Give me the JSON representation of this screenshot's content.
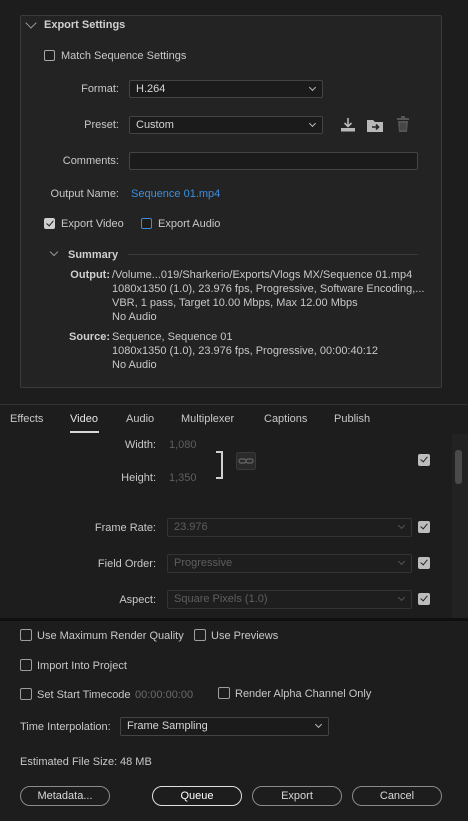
{
  "export_settings": {
    "title": "Export Settings",
    "match_sequence_label": "Match Sequence Settings",
    "format_label": "Format:",
    "format_value": "H.264",
    "preset_label": "Preset:",
    "preset_value": "Custom",
    "comments_label": "Comments:",
    "comments_value": "",
    "output_name_label": "Output Name:",
    "output_name_value": "Sequence 01.mp4",
    "export_video_label": "Export Video",
    "export_audio_label": "Export Audio"
  },
  "summary": {
    "title": "Summary",
    "output_label": "Output:",
    "output_lines": [
      "/Volume...019/Sharkerio/Exports/Vlogs MX/Sequence 01.mp4",
      "1080x1350 (1.0), 23.976 fps, Progressive, Software Encoding,...",
      "VBR, 1 pass, Target 10.00 Mbps, Max 12.00 Mbps",
      "No Audio"
    ],
    "source_label": "Source:",
    "source_lines": [
      "Sequence, Sequence 01",
      "1080x1350 (1.0), 23.976 fps, Progressive, 00:00:40:12",
      "No Audio"
    ]
  },
  "tabs": [
    {
      "label": "Effects"
    },
    {
      "label": "Video"
    },
    {
      "label": "Audio"
    },
    {
      "label": "Multiplexer"
    },
    {
      "label": "Captions"
    },
    {
      "label": "Publish"
    }
  ],
  "video": {
    "width_label": "Width:",
    "width_value": "1,080",
    "height_label": "Height:",
    "height_value": "1,350",
    "frame_rate_label": "Frame Rate:",
    "frame_rate_value": "23.976",
    "field_order_label": "Field Order:",
    "field_order_value": "Progressive",
    "aspect_label": "Aspect:",
    "aspect_value": "Square Pixels (1.0)"
  },
  "options": {
    "max_render_quality": "Use Maximum Render Quality",
    "use_previews": "Use Previews",
    "import_into_project": "Import Into Project",
    "set_start_timecode": "Set Start Timecode",
    "start_timecode_value": "00:00:00:00",
    "render_alpha": "Render Alpha Channel Only",
    "time_interpolation_label": "Time Interpolation:",
    "time_interpolation_value": "Frame Sampling",
    "estimated_size_label": "Estimated File Size:",
    "estimated_size_value": "48 MB"
  },
  "buttons": {
    "metadata": "Metadata...",
    "queue": "Queue",
    "export": "Export",
    "cancel": "Cancel"
  },
  "colors": {
    "accent_link": "#3b8fe0",
    "background": "#1d1d1d"
  }
}
